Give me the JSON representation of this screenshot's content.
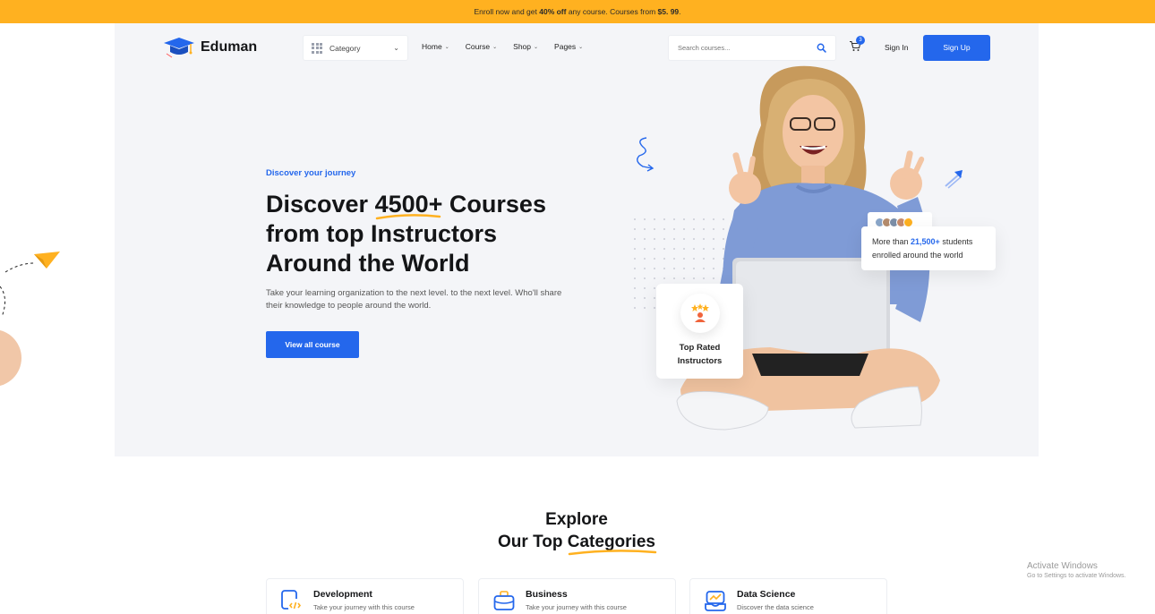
{
  "promo": {
    "prefix": "Enroll now and get ",
    "discount": "40% off",
    "middle": " any course. Courses from ",
    "price": "$5. 99",
    "suffix": "."
  },
  "header": {
    "brand": "Eduman",
    "category_label": "Category",
    "nav": [
      "Home",
      "Course",
      "Shop",
      "Pages"
    ],
    "search_placeholder": "Search courses...",
    "cart_count": "3",
    "signin": "Sign In",
    "signup": "Sign Up"
  },
  "hero": {
    "eyebrow": "Discover your journey",
    "headline_pre": "Discover ",
    "headline_highlight": "4500+",
    "headline_post": " Courses from top Instructors Around the World",
    "description": "Take your learning organization to the next level. to the next level. Who'll share their knowledge to people around the world.",
    "cta": "View all course",
    "rated_card": "Top Rated Instructors",
    "students_prefix": "More than ",
    "students_number": "21,500+",
    "students_suffix": " students enrolled around the world"
  },
  "explore": {
    "line1": "Explore",
    "line2_pre": "Our Top ",
    "line2_highlight": "Categories"
  },
  "categories": [
    {
      "title": "Development",
      "desc": "Take your journey with this course",
      "icon": "code-icon"
    },
    {
      "title": "Business",
      "desc": "Take your journey with this course",
      "icon": "briefcase-icon"
    },
    {
      "title": "Data Science",
      "desc": "Discover the data science",
      "icon": "data-icon"
    }
  ],
  "os_overlay": {
    "title": "Activate Windows",
    "subtitle": "Go to Settings to activate Windows."
  },
  "colors": {
    "accent": "#2467ec",
    "promo": "#ffb120",
    "highlight": "#ffb120"
  }
}
